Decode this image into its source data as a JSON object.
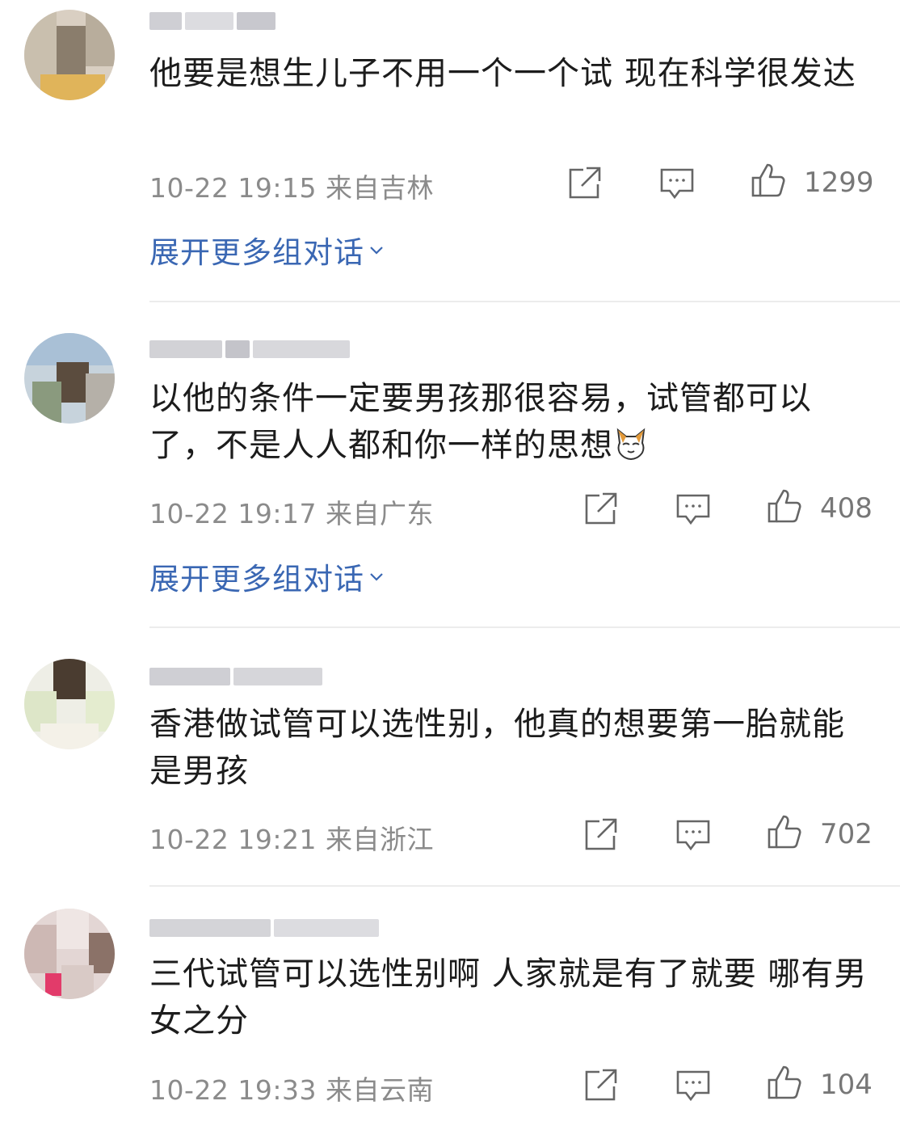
{
  "comments": [
    {
      "text": "他要是想生儿子不用一个一个试 现在科学很发达",
      "time": "10-22 19:15 来自吉林",
      "likes": "1299",
      "expand_label": "展开更多组对话"
    },
    {
      "text": "以他的条件一定要男孩那很容易，试管都可以了，不是人人都和你一样的思想",
      "time": "10-22 19:17 来自广东",
      "likes": "408",
      "expand_label": "展开更多组对话"
    },
    {
      "text": "香港做试管可以选性别，他真的想要第一胎就能是男孩",
      "time": "10-22 19:21 来自浙江",
      "likes": "702"
    },
    {
      "text": "三代试管可以选性别啊 人家就是有了就要 哪有男女之分",
      "time": "10-22 19:33 来自云南",
      "likes": "104"
    }
  ],
  "icons": {
    "share": "share-icon",
    "reply": "comment-icon",
    "like": "thumbs-up-icon",
    "expand": "chevron-down-icon",
    "emoji": "cat-face-emoji-icon"
  },
  "colors": {
    "link": "#3a67b3",
    "meta": "#8b8b8b",
    "text": "#1c1c1c"
  }
}
